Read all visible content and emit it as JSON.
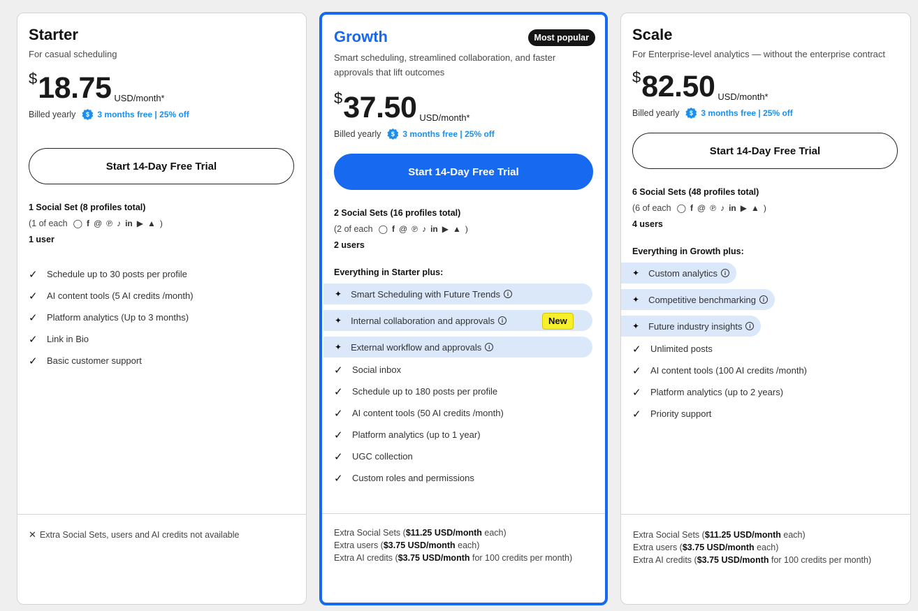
{
  "plans": [
    {
      "name": "Starter",
      "description": "For casual scheduling",
      "currency_symbol": "$",
      "price": "18.75",
      "price_unit": "USD/month*",
      "billed": "Billed yearly",
      "discount": "3 months free | 25% off",
      "cta": "Start 14-Day Free Trial",
      "sets_title": "1 Social Set (8 profiles total)",
      "sets_each": "(1 of each",
      "users": "1 user",
      "features": [
        "Schedule up to 30 posts per profile",
        "AI content tools (5 AI credits /month)",
        "Platform analytics (Up to 3 months)",
        "Link in Bio",
        "Basic customer support"
      ],
      "footer": "Extra Social Sets, users and AI credits not available"
    },
    {
      "name": "Growth",
      "badge": "Most popular",
      "description": "Smart scheduling, streamlined collaboration, and faster approvals that lift outcomes",
      "currency_symbol": "$",
      "price": "37.50",
      "price_unit": "USD/month*",
      "billed": "Billed yearly",
      "discount": "3 months free | 25% off",
      "cta": "Start 14-Day Free Trial",
      "sets_title": "2 Social Sets (16 profiles total)",
      "sets_each": "(2 of each",
      "users": "2 users",
      "plus_title": "Everything in Starter plus:",
      "highlights": [
        "Smart Scheduling with Future Trends",
        "Internal collaboration and approvals",
        "External workflow and approvals"
      ],
      "new_badge": "New",
      "features": [
        "Social inbox",
        "Schedule up to 180 posts per profile",
        "AI content tools (50 AI credits /month)",
        "Platform analytics (up to 1 year)",
        "UGC collection",
        "Custom roles and permissions"
      ],
      "footer_sets_pre": "Extra Social Sets (",
      "footer_sets_bold": "$11.25 USD/month",
      "footer_sets_post": " each)",
      "footer_users_pre": "Extra users (",
      "footer_users_bold": "$3.75 USD/month",
      "footer_users_post": " each)",
      "footer_ai_pre": "Extra AI credits (",
      "footer_ai_bold": "$3.75 USD/month",
      "footer_ai_post": " for 100 credits per month)"
    },
    {
      "name": "Scale",
      "description": "For Enterprise-level analytics — without the enterprise contract",
      "currency_symbol": "$",
      "price": "82.50",
      "price_unit": "USD/month*",
      "billed": "Billed yearly",
      "discount": "3 months free | 25% off",
      "cta": "Start 14-Day Free Trial",
      "sets_title": "6 Social Sets (48 profiles total)",
      "sets_each": "(6 of each",
      "users": "4 users",
      "plus_title": "Everything in Growth plus:",
      "highlights": [
        "Custom analytics",
        "Competitive benchmarking",
        "Future industry insights"
      ],
      "features": [
        "Unlimited posts",
        "AI content tools (100 AI credits /month)",
        "Platform analytics (up to 2 years)",
        "Priority support"
      ],
      "footer_sets_pre": "Extra Social Sets (",
      "footer_sets_bold": "$11.25 USD/month",
      "footer_sets_post": " each)",
      "footer_users_pre": "Extra users (",
      "footer_users_bold": "$3.75 USD/month",
      "footer_users_post": " each)",
      "footer_ai_pre": "Extra AI credits (",
      "footer_ai_bold": "$3.75 USD/month",
      "footer_ai_post": " for 100 credits per month)"
    }
  ],
  "social_icons": [
    "instagram-icon",
    "facebook-icon",
    "threads-icon",
    "pinterest-icon",
    "tiktok-icon",
    "linkedin-icon",
    "youtube-icon",
    "snapchat-icon"
  ],
  "colors": {
    "accent": "#1769f0",
    "highlight_bg": "#dbe8f9",
    "discount": "#1a8ff0",
    "new_badge": "#f7ef2a"
  }
}
